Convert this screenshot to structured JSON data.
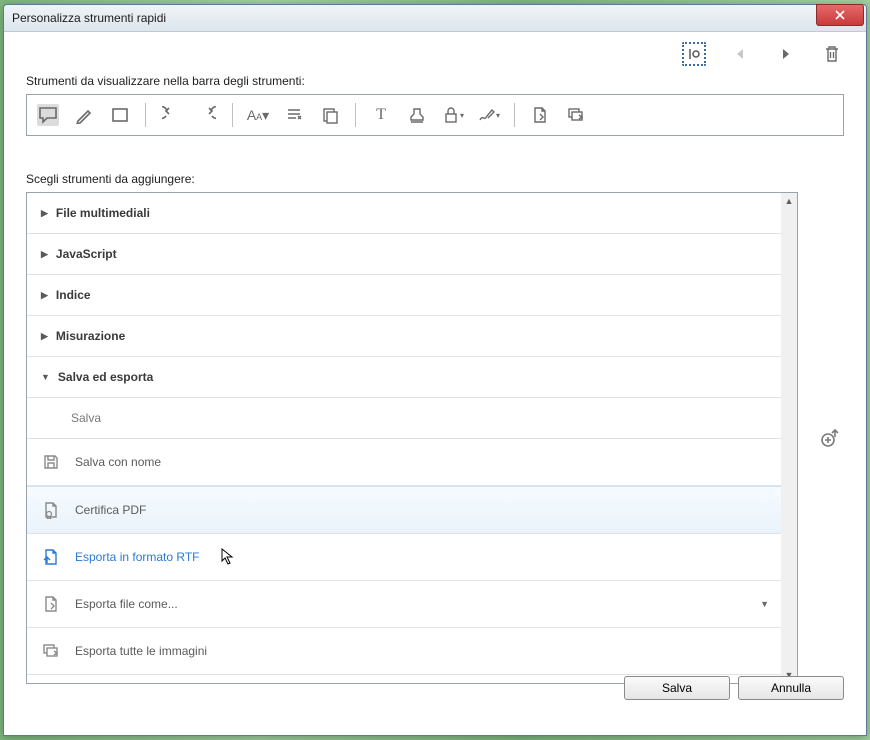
{
  "title": "Personalizza strumenti rapidi",
  "labels": {
    "toolbar_label": "Strumenti da visualizzare nella barra degli strumenti:",
    "choose_label": "Scegli strumenti da aggiungere:"
  },
  "categories": {
    "multimedia": "File multimediali",
    "javascript": "JavaScript",
    "index": "Indice",
    "measure": "Misurazione",
    "save_export": "Salva ed esporta"
  },
  "items": {
    "save": "Salva",
    "save_as": "Salva con nome",
    "certify": "Certifica PDF",
    "export_rtf": "Esporta in formato RTF",
    "export_as": "Esporta file come...",
    "export_images": "Esporta tutte le immagini"
  },
  "buttons": {
    "save": "Salva",
    "cancel": "Annulla"
  }
}
